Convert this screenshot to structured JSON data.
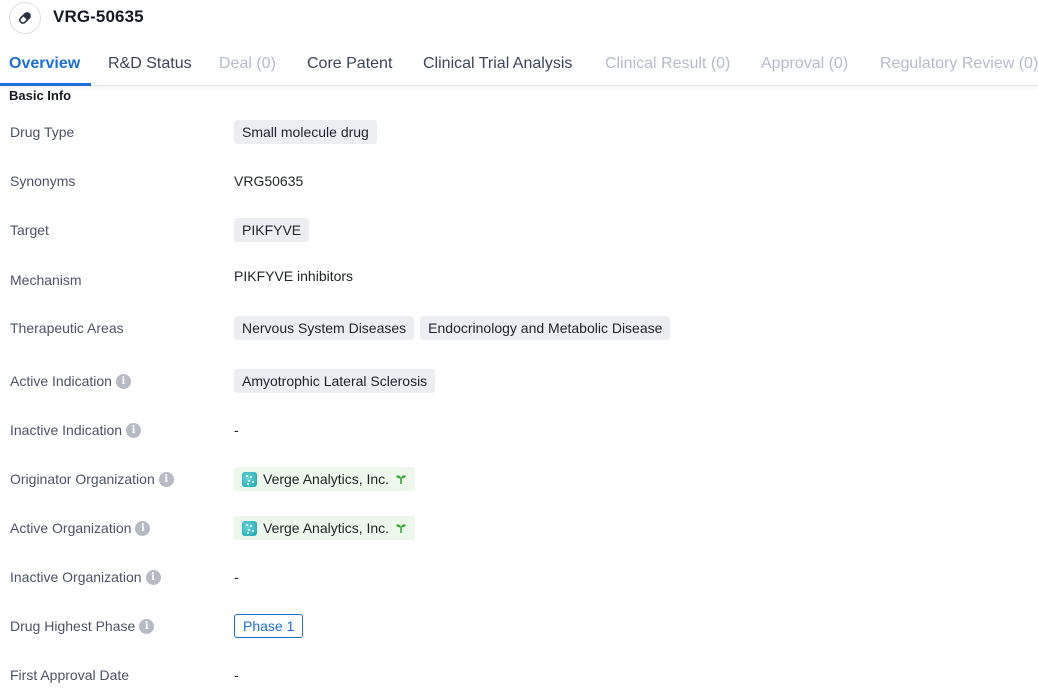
{
  "header": {
    "icon": "pill-icon",
    "title": "VRG-50635"
  },
  "tabs": [
    {
      "label": "Overview",
      "state": "active"
    },
    {
      "label": "R&D Status",
      "state": "normal"
    },
    {
      "label": "Deal (0)",
      "state": "disabled"
    },
    {
      "label": "Core Patent",
      "state": "normal"
    },
    {
      "label": "Clinical Trial Analysis",
      "state": "normal"
    },
    {
      "label": "Clinical Result (0)",
      "state": "disabled"
    },
    {
      "label": "Approval (0)",
      "state": "disabled"
    },
    {
      "label": "Regulatory Review (0)",
      "state": "disabled"
    }
  ],
  "section": {
    "title": "Basic Info"
  },
  "fields": {
    "drug_type": {
      "label": "Drug Type",
      "tags": [
        "Small molecule drug"
      ]
    },
    "synonyms": {
      "label": "Synonyms",
      "value": "VRG50635"
    },
    "target": {
      "label": "Target",
      "tags": [
        "PIKFYVE"
      ]
    },
    "mechanism": {
      "label": "Mechanism",
      "value": "PIKFYVE inhibitors"
    },
    "therapeutic_areas": {
      "label": "Therapeutic Areas",
      "tags": [
        "Nervous System Diseases",
        "Endocrinology and Metabolic Disease"
      ]
    },
    "active_indication": {
      "label": "Active Indication",
      "tags": [
        "Amyotrophic Lateral Sclerosis"
      ]
    },
    "inactive_indication": {
      "label": "Inactive Indication",
      "value": "-"
    },
    "originator_org": {
      "label": "Originator Organization",
      "org": "Verge Analytics, Inc."
    },
    "active_org": {
      "label": "Active Organization",
      "org": "Verge Analytics, Inc."
    },
    "inactive_org": {
      "label": "Inactive Organization",
      "value": "-"
    },
    "highest_phase": {
      "label": "Drug Highest Phase",
      "value": "Phase 1"
    },
    "first_approval": {
      "label": "First Approval Date",
      "value": "-"
    }
  },
  "info_icon_glyph": "i",
  "colors": {
    "accent": "#1d6fd6",
    "tag_bg": "#eceef2",
    "org_tag_bg": "#eef7ec",
    "sprout": "#3aa53a"
  }
}
